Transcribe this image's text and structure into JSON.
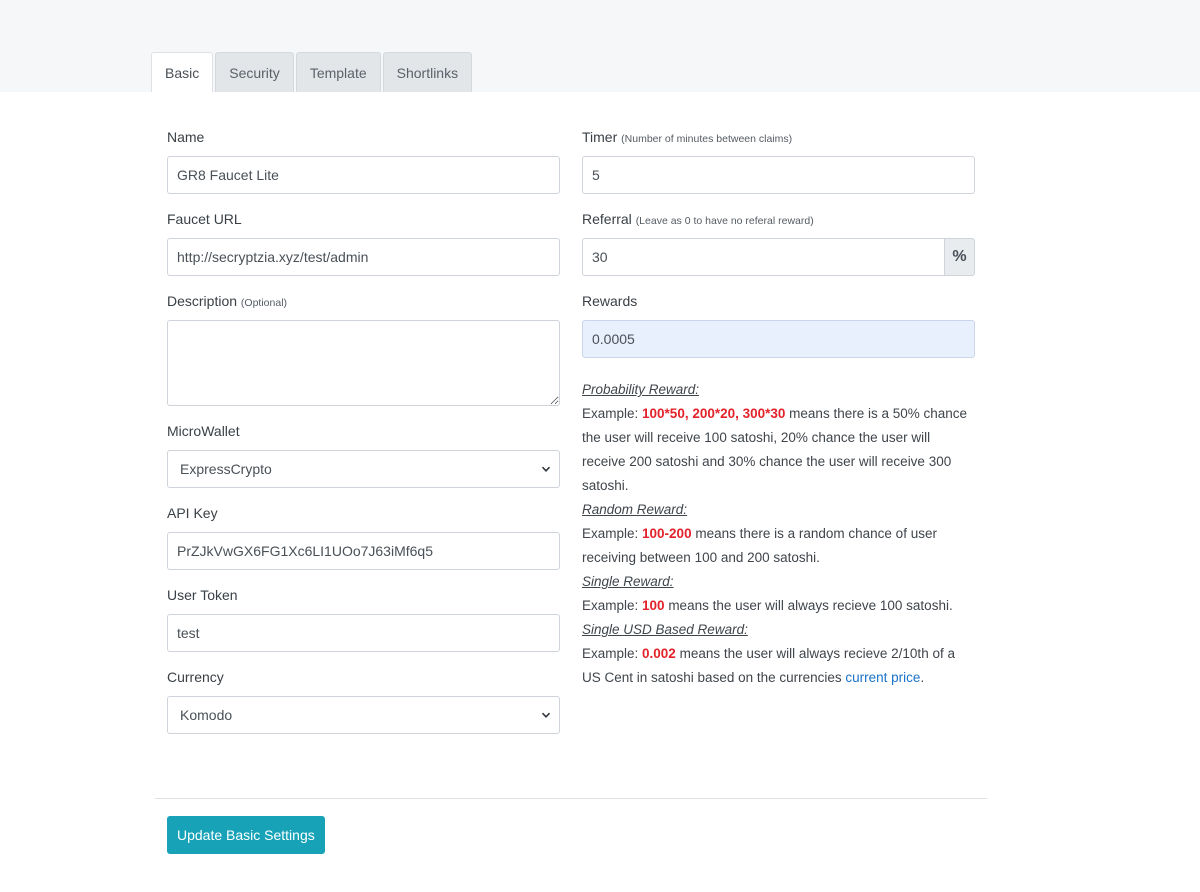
{
  "tabs": [
    "Basic",
    "Security",
    "Template",
    "Shortlinks"
  ],
  "left": {
    "name": {
      "label": "Name",
      "value": "GR8 Faucet Lite"
    },
    "faucet_url": {
      "label": "Faucet URL",
      "value": "http://secryptzia.xyz/test/admin"
    },
    "description": {
      "label": "Description",
      "note": "(Optional)",
      "value": ""
    },
    "microwallet": {
      "label": "MicroWallet",
      "selected": "ExpressCrypto"
    },
    "api_key": {
      "label": "API Key",
      "value": "PrZJkVwGX6FG1Xc6LI1UOo7J63iMf6q5"
    },
    "user_token": {
      "label": "User Token",
      "value": "test"
    },
    "currency": {
      "label": "Currency",
      "selected": "Komodo"
    }
  },
  "right": {
    "timer": {
      "label": "Timer",
      "note": "(Number of minutes between claims)",
      "value": "5"
    },
    "referral": {
      "label": "Referral",
      "note": "(Leave as 0 to have no referal reward)",
      "value": "30",
      "addon": "%"
    },
    "rewards": {
      "label": "Rewards",
      "value": "0.0005"
    },
    "help": {
      "probability_title": "Probability Reward:",
      "probability_prefix": "Example: ",
      "probability_example": "100*50, 200*20, 300*30",
      "probability_text": " means there is a 50% chance the user will receive 100 satoshi, 20% chance the user will receive 200 satoshi and 30% chance the user will receive 300 satoshi.",
      "random_title": "Random Reward:",
      "random_prefix": "Example: ",
      "random_example": "100-200",
      "random_text": " means there is a random chance of user receiving between 100 and 200 satoshi.",
      "single_title": "Single Reward:",
      "single_prefix": "Example: ",
      "single_example": "100",
      "single_text": " means the user will always recieve 100 satoshi.",
      "usd_title": "Single USD Based Reward:",
      "usd_prefix": "Example: ",
      "usd_example": "0.002",
      "usd_text": " means the user will always recieve 2/10th of a US Cent in satoshi based on the currencies ",
      "usd_link": "current price",
      "usd_suffix": "."
    }
  },
  "submit_label": "Update Basic Settings",
  "colors": {
    "accent": "#17a2b8",
    "example_red": "#e3222a",
    "link": "#1a73c8"
  }
}
